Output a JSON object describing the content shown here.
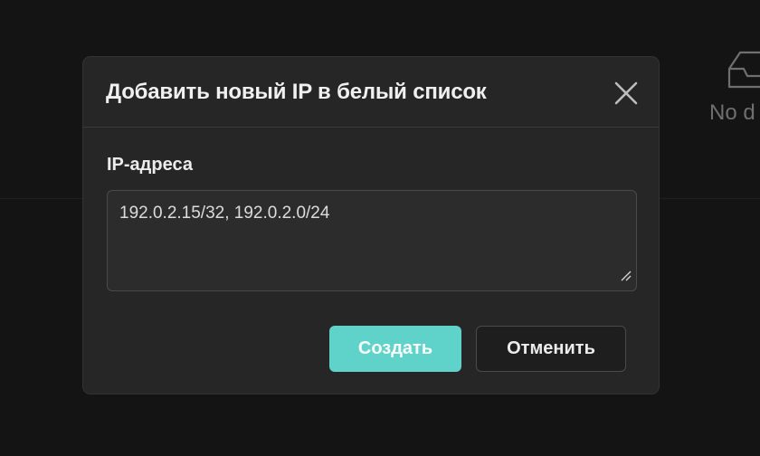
{
  "background": {
    "empty_state": {
      "icon": "inbox-icon",
      "text": "No d"
    }
  },
  "modal": {
    "title": "Добавить новый IP в белый список",
    "close_icon": "close-icon",
    "field": {
      "label": "IP-адреса",
      "value": "192.0.2.15/32, 192.0.2.0/24"
    },
    "buttons": {
      "create_label": "Создать",
      "cancel_label": "Отменить"
    }
  },
  "colors": {
    "accent": "#5fd3c9",
    "background": "#141414",
    "modal_bg": "#262626"
  }
}
